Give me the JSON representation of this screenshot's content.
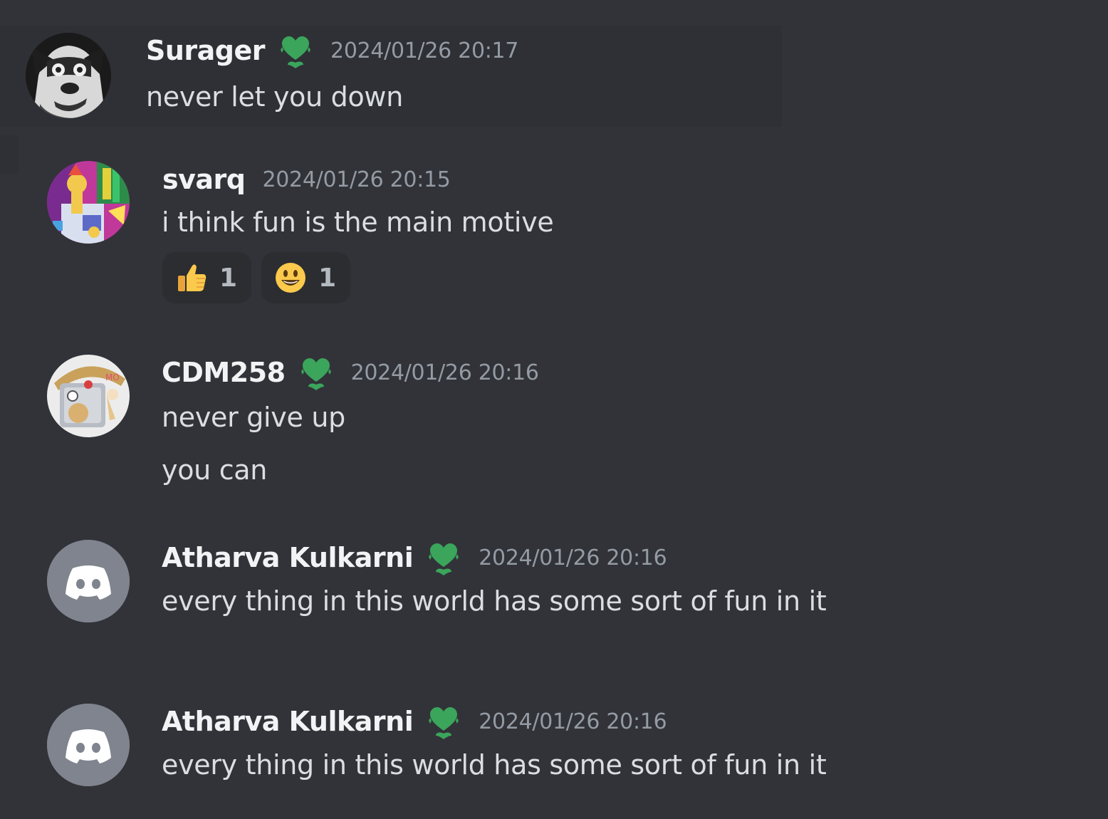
{
  "colors": {
    "background": "#313338",
    "hover_background": "#2e3035",
    "username": "#f2f3f5",
    "timestamp": "#949ba4",
    "message_text": "#dbdee1",
    "badge_green": "#3ba55c",
    "reaction_background": "#2b2d31",
    "default_avatar": "#80848e"
  },
  "messages": [
    {
      "username": "Surager",
      "badge": "green-heart-badge-icon",
      "timestamp": "2024/01/26 20:17",
      "lines": [
        "never let you down"
      ],
      "avatar": "husky-avatar"
    },
    {
      "username": "svarq",
      "timestamp": "2024/01/26 20:15",
      "lines": [
        "i think fun is the main motive"
      ],
      "avatar": "colorful-art-avatar",
      "reactions": [
        {
          "emoji": "thumbs-up-icon",
          "count": "1"
        },
        {
          "emoji": "smiley-face-icon",
          "count": "1"
        }
      ]
    },
    {
      "username": "CDM258",
      "badge": "green-heart-badge-icon",
      "timestamp": "2024/01/26 20:16",
      "lines": [
        "never give up",
        "you can"
      ],
      "avatar": "cartoon-avatar"
    },
    {
      "username": "Atharva Kulkarni",
      "badge": "green-heart-badge-icon",
      "timestamp": "2024/01/26 20:16",
      "lines": [
        "every thing in this world has some sort of fun in it"
      ],
      "avatar": "discord-default-avatar"
    },
    {
      "username": "Atharva Kulkarni",
      "badge": "green-heart-badge-icon",
      "timestamp": "2024/01/26 20:16",
      "lines": [
        "every thing in this world has some sort of fun in it"
      ],
      "avatar": "discord-default-avatar"
    }
  ]
}
